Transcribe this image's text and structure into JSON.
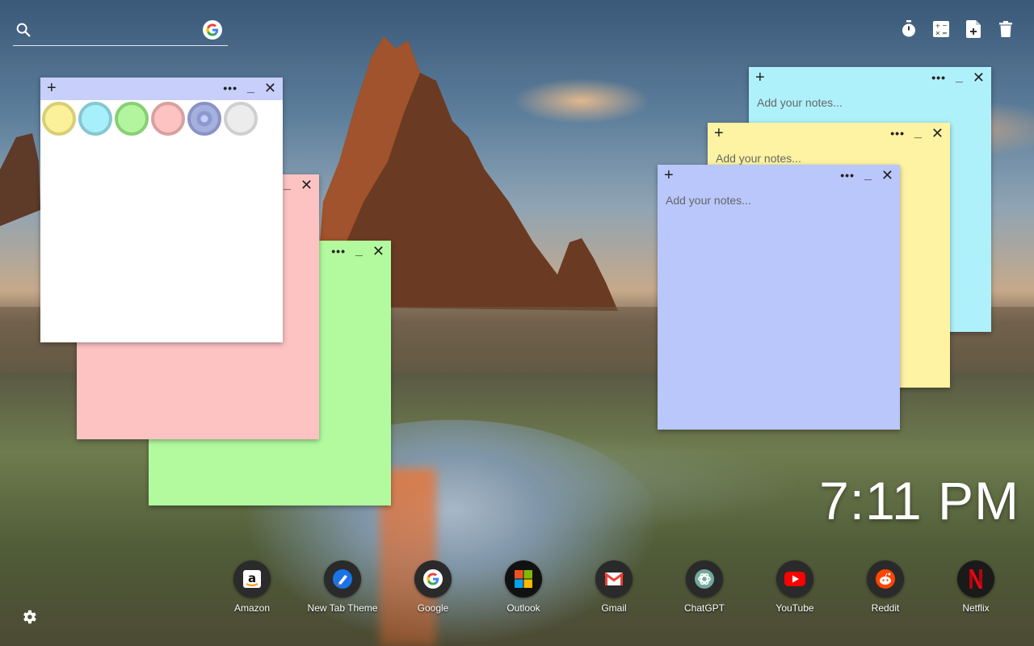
{
  "search": {
    "value": "",
    "placeholder": ""
  },
  "toolbar": {
    "items": [
      {
        "icon": "timer-icon"
      },
      {
        "icon": "calculator-icon"
      },
      {
        "icon": "new-note-icon"
      },
      {
        "icon": "trash-icon"
      }
    ]
  },
  "notes": {
    "white": {
      "color": "#ffffff",
      "placeholder": "",
      "palette": [
        "#fbf19a",
        "#a7f0fb",
        "#b3f59f",
        "#fdc3c3",
        "#a6b0dd",
        "#ececec"
      ]
    },
    "pink": {
      "color": "#fdc3c3"
    },
    "green": {
      "color": "#b3fa9f"
    },
    "cyan": {
      "color": "#aff1fb",
      "placeholder": "Add your notes..."
    },
    "yellow": {
      "color": "#fdf3a3",
      "placeholder": "Add your notes..."
    },
    "periwinkle": {
      "color": "#b9c7fb",
      "placeholder": "Add your notes..."
    },
    "plus_label": "+",
    "dots_label": "•••",
    "min_label": "_",
    "close_label": "✕"
  },
  "clock": {
    "time": "7:11 PM"
  },
  "shortcuts": [
    {
      "label": "Amazon",
      "icon": "amazon-icon"
    },
    {
      "label": "New Tab Theme",
      "icon": "new-tab-theme-icon"
    },
    {
      "label": "Google",
      "icon": "google-icon"
    },
    {
      "label": "Outlook",
      "icon": "microsoft-icon"
    },
    {
      "label": "Gmail",
      "icon": "gmail-icon"
    },
    {
      "label": "ChatGPT",
      "icon": "chatgpt-icon"
    },
    {
      "label": "YouTube",
      "icon": "youtube-icon"
    },
    {
      "label": "Reddit",
      "icon": "reddit-icon"
    },
    {
      "label": "Netflix",
      "icon": "netflix-icon"
    }
  ],
  "colors": {
    "accent_google_blue": "#4285F4",
    "accent_google_red": "#EA4335",
    "accent_google_yellow": "#FBBC05",
    "accent_google_green": "#34A853"
  }
}
